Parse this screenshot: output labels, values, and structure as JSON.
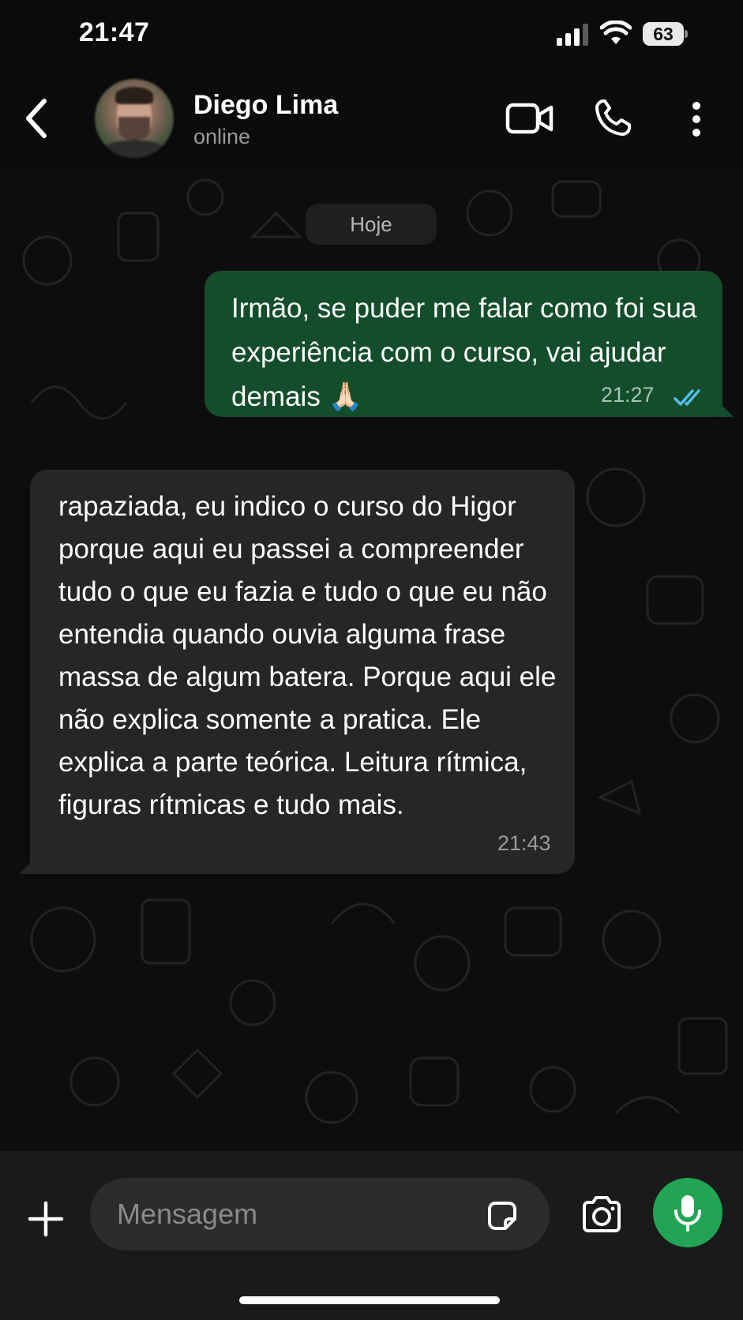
{
  "status_bar": {
    "time": "21:47",
    "battery": "63",
    "icons": [
      "signal-icon",
      "wifi-icon",
      "battery-icon"
    ]
  },
  "header": {
    "contact_name": "Diego Lima",
    "contact_status": "online",
    "icons": [
      "back-icon",
      "video-call-icon",
      "phone-icon",
      "more-vertical-icon"
    ]
  },
  "chat": {
    "date_separator": "Hoje",
    "messages": [
      {
        "direction": "outgoing",
        "text": "Irmão, se puder me falar como foi sua experiência com o curso, vai ajudar demais 🙏🏻",
        "time": "21:27",
        "status": "read"
      },
      {
        "direction": "incoming",
        "text": "rapaziada, eu indico o curso do Higor porque aqui eu passei a compreender tudo o que eu fazia e tudo o que eu não entendia quando ouvia alguma frase massa de algum batera. Porque aqui ele não explica somente a pratica. Ele explica a parte teórica. Leitura rítmica, figuras rítmicas e tudo mais.",
        "time": "21:43"
      }
    ]
  },
  "composer": {
    "placeholder": "Mensagem",
    "value": "",
    "icons": [
      "plus-icon",
      "sticker-icon",
      "camera-icon",
      "microphone-icon"
    ]
  },
  "colors": {
    "outgoing_bubble": "#144d2c",
    "incoming_bubble": "#262626",
    "read_ticks": "#53bdeb",
    "mic_button": "#21a453"
  }
}
